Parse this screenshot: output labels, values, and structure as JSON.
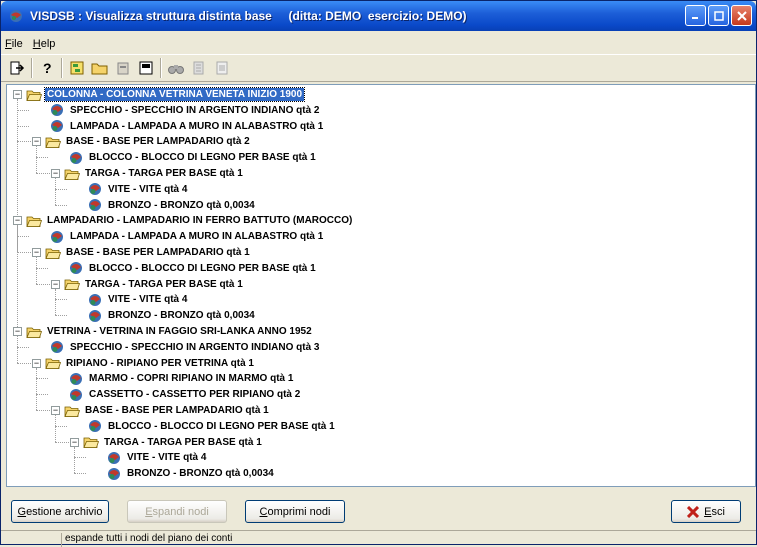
{
  "window": {
    "title": "VISDSB : Visualizza struttura distinta base     (ditta: DEMO  esercizio: DEMO)"
  },
  "menu": [
    {
      "label": "File",
      "key": "F"
    },
    {
      "label": "Help",
      "key": "H"
    }
  ],
  "toolbar": [
    "exit-icon",
    "help-icon",
    "expand-icon",
    "folder-icon",
    "collapse-icon",
    "save-icon",
    "binoculars-icon",
    "find-next-icon",
    "print-icon"
  ],
  "tree": [
    {
      "level": 0,
      "type": "folder",
      "expanded": true,
      "text": "COLONNA - COLONNA VETRINA VENETA INIZIO 1900",
      "selected": true
    },
    {
      "level": 1,
      "type": "item",
      "text": "SPECCHIO - SPECCHIO IN ARGENTO INDIANO  qtà 2"
    },
    {
      "level": 1,
      "type": "item",
      "text": "LAMPADA - LAMPADA A MURO IN ALABASTRO  qtà 1"
    },
    {
      "level": 1,
      "type": "folder",
      "expanded": true,
      "text": "BASE - BASE PER LAMPADARIO  qtà 2"
    },
    {
      "level": 2,
      "type": "item",
      "text": "BLOCCO - BLOCCO DI LEGNO PER BASE  qtà 1"
    },
    {
      "level": 2,
      "type": "folder",
      "expanded": true,
      "text": "TARGA - TARGA PER BASE  qtà 1"
    },
    {
      "level": 3,
      "type": "item",
      "text": "VITE - VITE  qtà 4"
    },
    {
      "level": 3,
      "type": "item",
      "text": "BRONZO - BRONZO  qtà 0,0034"
    },
    {
      "level": 0,
      "type": "folder",
      "expanded": true,
      "text": "LAMPADARIO - LAMPADARIO IN FERRO BATTUTO (MAROCCO)"
    },
    {
      "level": 1,
      "type": "item",
      "text": "LAMPADA - LAMPADA A MURO IN ALABASTRO  qtà 1"
    },
    {
      "level": 1,
      "type": "folder",
      "expanded": true,
      "text": "BASE - BASE PER LAMPADARIO  qtà 1"
    },
    {
      "level": 2,
      "type": "item",
      "text": "BLOCCO - BLOCCO DI LEGNO PER BASE  qtà 1"
    },
    {
      "level": 2,
      "type": "folder",
      "expanded": true,
      "text": "TARGA - TARGA PER BASE  qtà 1"
    },
    {
      "level": 3,
      "type": "item",
      "text": "VITE - VITE  qtà 4"
    },
    {
      "level": 3,
      "type": "item",
      "text": "BRONZO - BRONZO  qtà 0,0034"
    },
    {
      "level": 0,
      "type": "folder",
      "expanded": true,
      "text": "VETRINA - VETRINA IN FAGGIO SRI-LANKA ANNO 1952"
    },
    {
      "level": 1,
      "type": "item",
      "text": "SPECCHIO - SPECCHIO IN ARGENTO INDIANO  qtà 3"
    },
    {
      "level": 1,
      "type": "folder",
      "expanded": true,
      "text": "RIPIANO - RIPIANO PER VETRINA  qtà 1"
    },
    {
      "level": 2,
      "type": "item",
      "text": "MARMO - COPRI RIPIANO IN MARMO  qtà 1"
    },
    {
      "level": 2,
      "type": "item",
      "text": "CASSETTO - CASSETTO PER RIPIANO  qtà 2"
    },
    {
      "level": 2,
      "type": "folder",
      "expanded": true,
      "text": "BASE - BASE PER LAMPADARIO  qtà 1"
    },
    {
      "level": 3,
      "type": "item",
      "text": "BLOCCO - BLOCCO DI LEGNO PER BASE  qtà 1"
    },
    {
      "level": 3,
      "type": "folder",
      "expanded": true,
      "text": "TARGA - TARGA PER BASE  qtà 1"
    },
    {
      "level": 4,
      "type": "item",
      "text": "VITE - VITE  qtà 4"
    },
    {
      "level": 4,
      "type": "item",
      "text": "BRONZO - BRONZO  qtà 0,0034"
    }
  ],
  "buttons": {
    "archive": {
      "first": "G",
      "rest": "estione archivio"
    },
    "expand": {
      "first": "E",
      "rest": "spandi nodi"
    },
    "collapse": {
      "first": "C",
      "rest": "omprimi nodi"
    },
    "exit": {
      "first": "E",
      "rest": "sci"
    }
  },
  "status": "espande tutti i nodi del piano dei conti",
  "colors": {
    "title_bar": "#0a49c9",
    "selection": "#316ac5",
    "folder": "#f5d36a"
  }
}
